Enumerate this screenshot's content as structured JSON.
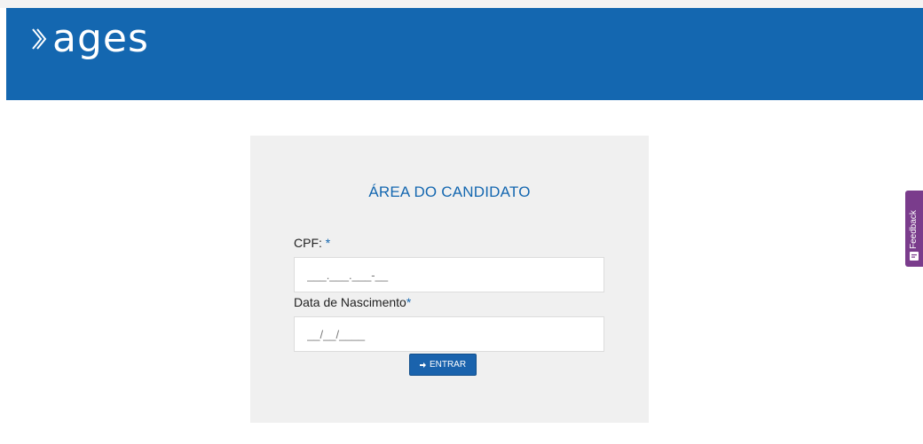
{
  "header": {
    "logo_text": "ages",
    "brand_color": "#1467b0"
  },
  "login": {
    "title": "ÁREA DO CANDIDATO",
    "cpf_label": "CPF:",
    "cpf_required": "*",
    "cpf_placeholder": "___.___.___-__",
    "birth_label": "Data de Nascimento",
    "birth_required": "*",
    "birth_placeholder": "__/__/____",
    "submit_label": "ENTRAR",
    "submit_icon": "sign-in-icon"
  },
  "feedback": {
    "label": "Feedback",
    "color": "#7a3c8c",
    "icon": "comment-icon"
  }
}
